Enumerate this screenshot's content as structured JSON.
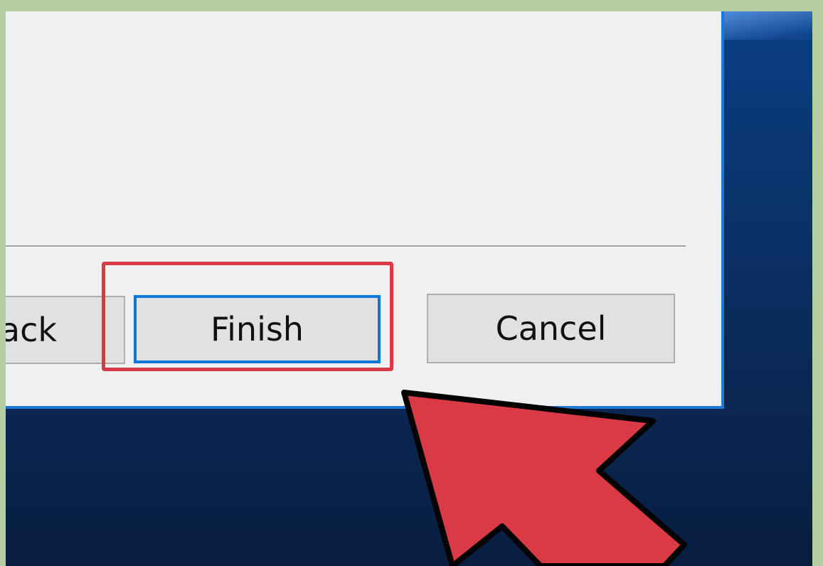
{
  "dialog": {
    "buttons": {
      "back_label": "ack",
      "finish_label": "Finish",
      "cancel_label": "Cancel"
    }
  },
  "annotation": {
    "highlight_color": "#d93a46",
    "arrow_color": "#d93a46",
    "pointer_icon": "red-arrow-icon"
  },
  "colors": {
    "accent": "#0a78d7",
    "dialog_bg": "#f0f0f0",
    "desktop_bg": "#0b2f63",
    "frame": "#b5cfa3"
  }
}
